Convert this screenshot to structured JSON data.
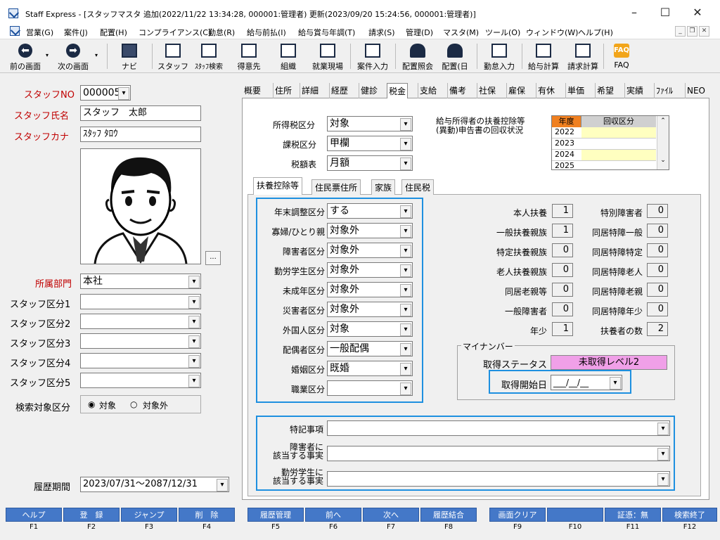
{
  "window": {
    "title": "Staff Express - [スタッフマスタ 追加(2022/11/22 13:34:28, 000001:管理者) 更新(2023/09/20 15:24:56, 000001:管理者)]",
    "min": "–",
    "max": "☐",
    "close": "✕"
  },
  "menu": [
    "営業(G)",
    "案件(J)",
    "配置(H)",
    "コンプライアンス(C)",
    "勤怠(R)",
    "給与前払(I)",
    "給与賞与年調(T)",
    "請求(S)",
    "管理(D)",
    "マスタ(M)",
    "ツール(O)",
    "ウィンドウ(W)",
    "ヘルプ(H)"
  ],
  "toolbar": [
    {
      "label": "前の画面",
      "icon": "back-icon"
    },
    {
      "label": "次の画面",
      "icon": "forward-icon"
    },
    {
      "label": "ナビ",
      "icon": "keyboard-icon"
    },
    {
      "label": "スタッフ",
      "icon": "staff-icon"
    },
    {
      "label": "ｽﾀｯﾌ検索",
      "icon": "staff-search-icon"
    },
    {
      "label": "得意先",
      "icon": "client-icon"
    },
    {
      "label": "組織",
      "icon": "organization-icon"
    },
    {
      "label": "就業現場",
      "icon": "worksite-icon"
    },
    {
      "label": "案件入力",
      "icon": "project-input-icon"
    },
    {
      "label": "配置照会",
      "icon": "assignment-inquiry-icon"
    },
    {
      "label": "配置(日",
      "icon": "assignment-daily-icon"
    },
    {
      "label": "勤怠入力",
      "icon": "attendance-input-icon"
    },
    {
      "label": "給与計算",
      "icon": "payroll-icon"
    },
    {
      "label": "請求計算",
      "icon": "billing-icon"
    },
    {
      "label": "FAQ",
      "icon": "faq-icon"
    }
  ],
  "left": {
    "staff_no_label": "スタッフNO",
    "staff_no": "000005",
    "name_label": "スタッフ氏名",
    "name": "スタッフ　太郎",
    "kana_label": "スタッフカナ",
    "kana": "ｽﾀｯﾌ ﾀﾛｳ",
    "photo_button": "...",
    "dept_label": "所属部門",
    "dept": "本社",
    "class1": "スタッフ区分1",
    "class2": "スタッフ区分2",
    "class3": "スタッフ区分3",
    "class4": "スタッフ区分4",
    "class5": "スタッフ区分5",
    "search_label": "検索対象区分",
    "radio_yes": "対象",
    "radio_no": "対象外",
    "history_label": "履歴期間",
    "history": "2023/07/31～2087/12/31"
  },
  "tabs": [
    "概要",
    "住所",
    "詳細",
    "経歴",
    "健診",
    "税金",
    "支給",
    "備考",
    "社保",
    "雇保",
    "有休",
    "単価",
    "希望",
    "実績",
    "ﾌｧｲﾙ",
    "NEO"
  ],
  "tax": {
    "income_label": "所得税区分",
    "income": "対象",
    "tax_class_label": "課税区分",
    "tax_class": "甲欄",
    "table_label": "税額表",
    "table": "月額",
    "recovery_label": "給与所得者の扶養控除等\n(異動)申告書の回収状況",
    "year_header": "年度",
    "recovery_header": "回収区分",
    "years": [
      "2022",
      "2023",
      "2024",
      "2025"
    ]
  },
  "inner_tabs": [
    "扶養控除等",
    "住民票住所",
    "家族",
    "住民税"
  ],
  "deduction": [
    {
      "label": "年末調整区分",
      "value": "する"
    },
    {
      "label": "寡婦/ひとり親",
      "value": "対象外"
    },
    {
      "label": "障害者区分",
      "value": "対象外"
    },
    {
      "label": "勤労学生区分",
      "value": "対象外"
    },
    {
      "label": "未成年区分",
      "value": "対象外"
    },
    {
      "label": "災害者区分",
      "value": "対象外"
    },
    {
      "label": "外国人区分",
      "value": "対象"
    },
    {
      "label": "配偶者区分",
      "value": "一般配偶"
    },
    {
      "label": "婚姻区分",
      "value": "既婚"
    },
    {
      "label": "職業区分",
      "value": ""
    }
  ],
  "counts_left": [
    {
      "label": "本人扶養",
      "value": "1"
    },
    {
      "label": "一般扶養親族",
      "value": "1"
    },
    {
      "label": "特定扶養親族",
      "value": "0"
    },
    {
      "label": "老人扶養親族",
      "value": "0"
    },
    {
      "label": "同居老親等",
      "value": "0"
    },
    {
      "label": "一般障害者",
      "value": "0"
    },
    {
      "label": "年少",
      "value": "1"
    }
  ],
  "counts_right": [
    {
      "label": "特別障害者",
      "value": "0"
    },
    {
      "label": "同居特障一般",
      "value": "0"
    },
    {
      "label": "同居特障特定",
      "value": "0"
    },
    {
      "label": "同居特障老人",
      "value": "0"
    },
    {
      "label": "同居特障老親",
      "value": "0"
    },
    {
      "label": "同居特障年少",
      "value": "0"
    },
    {
      "label": "扶養者の数",
      "value": "2"
    }
  ],
  "mynumber": {
    "group": "マイナンバー",
    "status_label": "取得ステータス",
    "status": "未取得レベル2",
    "start_label": "取得開始日",
    "start": "___/__/__"
  },
  "notes": {
    "special": "特記事項",
    "disabled": "障害者に\n該当する事実",
    "student": "勤労学生に\n該当する事実"
  },
  "fkeys": [
    {
      "label": "ヘルプ",
      "key": "F1"
    },
    {
      "label": "登　録",
      "key": "F2"
    },
    {
      "label": "ジャンプ",
      "key": "F3"
    },
    {
      "label": "削　除",
      "key": "F4"
    },
    {
      "label": "履歴管理",
      "key": "F5"
    },
    {
      "label": "前へ",
      "key": "F6"
    },
    {
      "label": "次へ",
      "key": "F7"
    },
    {
      "label": "履歴結合",
      "key": "F8"
    },
    {
      "label": "画面クリア",
      "key": "F9"
    },
    {
      "label": "",
      "key": "F10"
    },
    {
      "label": "証憑：無",
      "key": "F11"
    },
    {
      "label": "検索終了",
      "key": "F12"
    }
  ],
  "colors": {
    "fkey": "#4478c8",
    "highlight_box": "#1e90e0",
    "status_bg": "#f0a0e8",
    "year_header": "#f08020",
    "year_row": "#ffffc0"
  }
}
